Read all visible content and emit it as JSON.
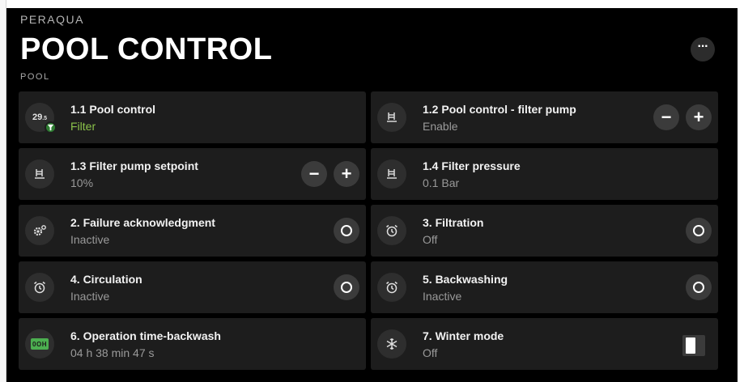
{
  "header": {
    "brand": "PERAQUA",
    "title": "POOL CONTROL",
    "subtitle": "POOL",
    "more_label": "···"
  },
  "cards": [
    {
      "name": "1.1  Pool control",
      "state": "Filter",
      "temp": "29",
      "temp_dec": ".5",
      "icon": "thermometer-icon"
    },
    {
      "name": "1.2  Pool control - filter pump",
      "state": "Enable",
      "icon": "pump-icon"
    },
    {
      "name": "1.3 Filter pump setpoint",
      "state": "10%",
      "icon": "pump-icon"
    },
    {
      "name": "1.4  Filter pressure",
      "state": "0.1 Bar",
      "icon": "pump-icon"
    },
    {
      "name": "2.  Failure acknowledgment",
      "state": "Inactive",
      "icon": "gear-icon"
    },
    {
      "name": "3.  Filtration",
      "state": "Off",
      "icon": "alarm-clock-icon"
    },
    {
      "name": "4. Circulation",
      "state": "Inactive",
      "icon": "alarm-clock-icon"
    },
    {
      "name": "5.  Backwashing",
      "state": "Inactive",
      "icon": "alarm-clock-icon"
    },
    {
      "name": "6. Operation time-backwash",
      "state": "04 h 38 min 47 s",
      "icon": "hour-counter-icon",
      "icon_text": "0OH"
    },
    {
      "name": "7.  Winter mode",
      "state": "Off",
      "icon": "snowflake-icon"
    }
  ],
  "buttons": {
    "minus": "−",
    "plus": "+"
  },
  "colors": {
    "background": "#000000",
    "card": "#1d1d1d",
    "accent_green": "#8bc34a"
  }
}
